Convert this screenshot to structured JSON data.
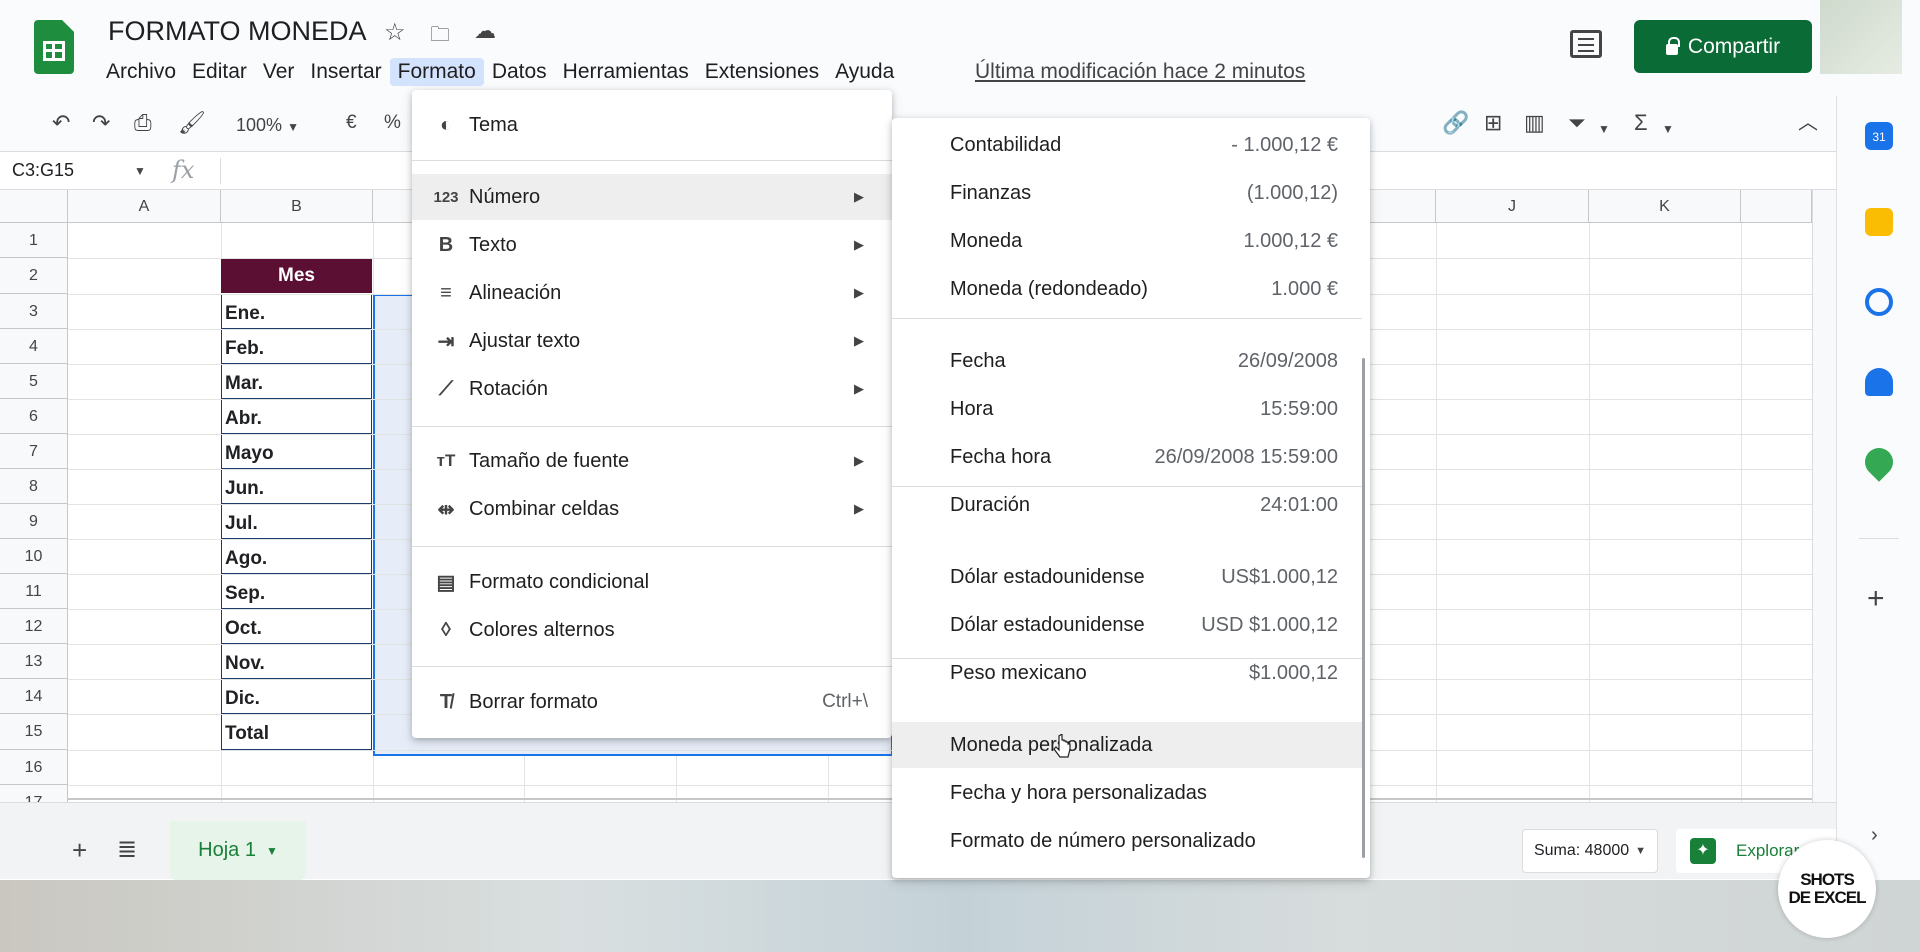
{
  "header": {
    "doc_title": "FORMATO MONEDA",
    "menus": [
      "Archivo",
      "Editar",
      "Ver",
      "Insertar",
      "Formato",
      "Datos",
      "Herramientas",
      "Extensiones",
      "Ayuda"
    ],
    "last_edit": "Última modificación hace 2 minutos",
    "share_label": "Compartir"
  },
  "toolbar": {
    "zoom": "100%",
    "currency": "€",
    "percent": "%"
  },
  "formula_bar": {
    "name_box": "C3:G15",
    "fx": "fx"
  },
  "grid": {
    "columns": [
      "A",
      "B",
      "J",
      "K"
    ],
    "rows": [
      "1",
      "2",
      "3",
      "4",
      "5",
      "6",
      "7",
      "8",
      "9",
      "10",
      "11",
      "12",
      "13",
      "14",
      "15",
      "16",
      "17"
    ],
    "header_cell": "Mes",
    "months": [
      "Ene.",
      "Feb.",
      "Mar.",
      "Abr.",
      "Mayo",
      "Jun.",
      "Jul.",
      "Ago.",
      "Sep.",
      "Oct.",
      "Nov.",
      "Dic."
    ],
    "total_label": "Total"
  },
  "format_menu": {
    "items": [
      {
        "icon": "palette-icon",
        "label": "Tema"
      },
      {
        "icon": "numbers-icon",
        "label": "Número"
      },
      {
        "icon": "bold-icon",
        "label": "Texto"
      },
      {
        "icon": "align-icon",
        "label": "Alineación"
      },
      {
        "icon": "wrap-icon",
        "label": "Ajustar texto"
      },
      {
        "icon": "rotate-icon",
        "label": "Rotación"
      },
      {
        "icon": "font-size-icon",
        "label": "Tamaño de fuente"
      },
      {
        "icon": "merge-icon",
        "label": "Combinar celdas"
      },
      {
        "icon": "paint-format-icon",
        "label": "Formato condicional"
      },
      {
        "icon": "fill-drop-icon",
        "label": "Colores alternos"
      },
      {
        "icon": "clear-format-icon",
        "label": "Borrar formato",
        "shortcut": "Ctrl+\\"
      }
    ],
    "numbers_glyph": "123"
  },
  "number_submenu": {
    "items": [
      {
        "label": "Contabilidad",
        "value": "- 1.000,12 €"
      },
      {
        "label": "Finanzas",
        "value": "(1.000,12)"
      },
      {
        "label": "Moneda",
        "value": "1.000,12 €"
      },
      {
        "label": "Moneda (redondeado)",
        "value": "1.000 €"
      },
      {
        "label": "Fecha",
        "value": "26/09/2008"
      },
      {
        "label": "Hora",
        "value": "15:59:00"
      },
      {
        "label": "Fecha hora",
        "value": "26/09/2008 15:59:00"
      },
      {
        "label": "Duración",
        "value": "24:01:00"
      },
      {
        "label": "Dólar estadounidense",
        "value": "US$1.000,12"
      },
      {
        "label": "Dólar estadounidense",
        "value": "USD $1.000,12"
      },
      {
        "label": "Peso mexicano",
        "value": "$1.000,12"
      },
      {
        "label": "Moneda personalizada",
        "value": ""
      },
      {
        "label": "Fecha y hora personalizadas",
        "value": ""
      },
      {
        "label": "Formato de número personalizado",
        "value": ""
      }
    ]
  },
  "sheet_bar": {
    "add": "+",
    "list": "≣",
    "tab": "Hoja 1",
    "sum": "Suma: 48000",
    "explore": "Explorar"
  },
  "watermark": {
    "line1": "SHOTS",
    "line2": "DE EXCEL"
  },
  "colors": {
    "brand": "#0b6b36",
    "header_fill": "#5a0f33",
    "selection": "#1a73e8"
  }
}
